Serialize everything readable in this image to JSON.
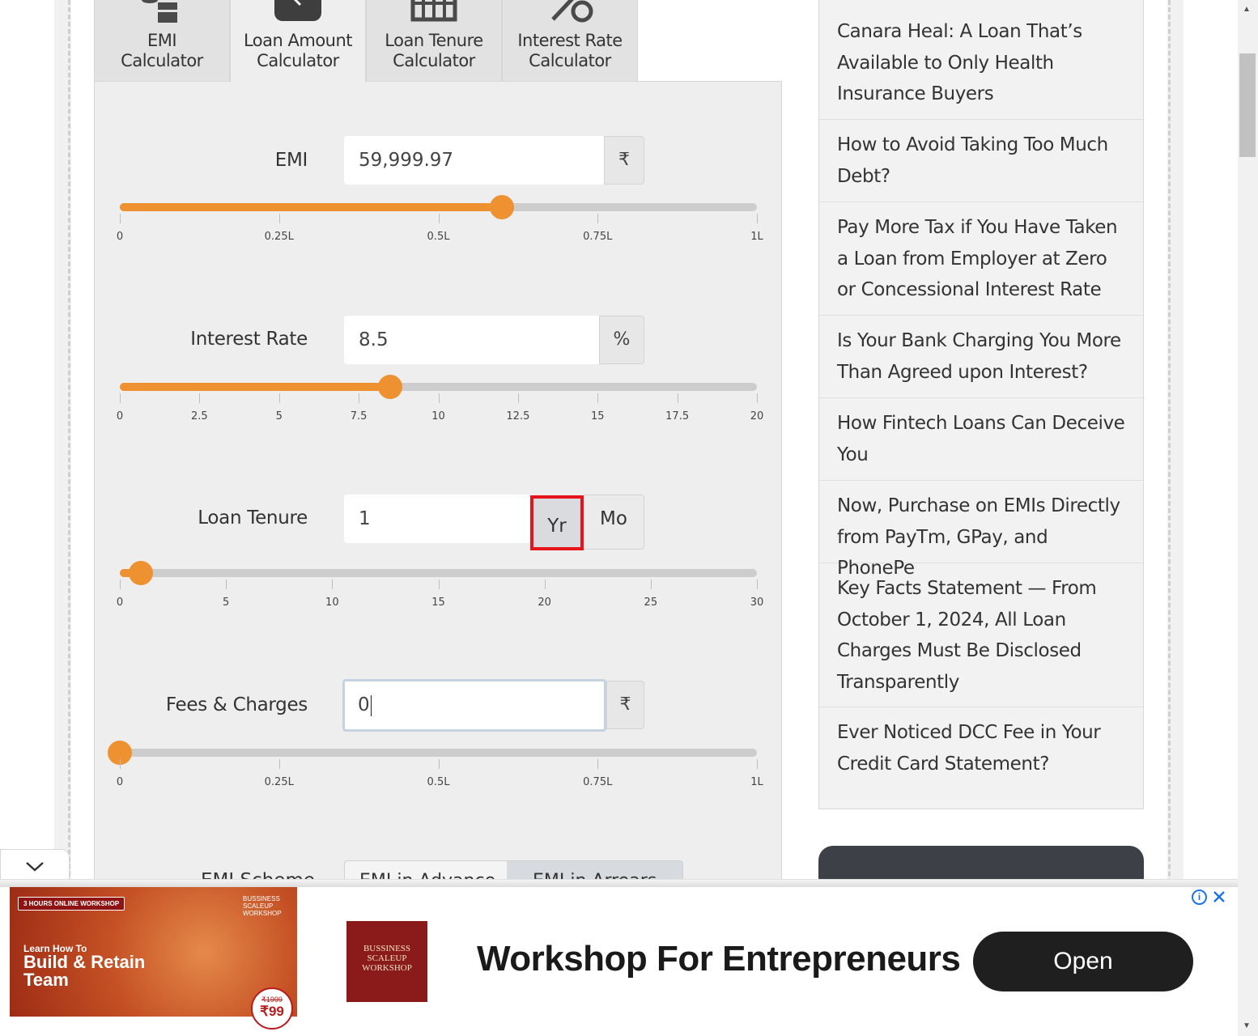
{
  "tabs": [
    {
      "label": "EMI\nCalculator",
      "icon": "coins-icon"
    },
    {
      "label": "Loan Amount\nCalculator",
      "icon": "money-icon"
    },
    {
      "label": "Loan Tenure\nCalculator",
      "icon": "calendar-icon"
    },
    {
      "label": "Interest Rate\nCalculator",
      "icon": "percent-icon"
    }
  ],
  "emi": {
    "label": "EMI",
    "value": "59,999.97",
    "unit": "₹",
    "slider_fraction": 0.6,
    "ticks": [
      "0",
      "0.25L",
      "0.5L",
      "0.75L",
      "1L"
    ]
  },
  "interest": {
    "label": "Interest Rate",
    "value": "8.5",
    "unit": "%",
    "slider_value": 8.5,
    "slider_max": 20,
    "ticks": [
      "0",
      "2.5",
      "5",
      "7.5",
      "10",
      "12.5",
      "15",
      "17.5",
      "20"
    ]
  },
  "tenure": {
    "label": "Loan Tenure",
    "value": "1",
    "unit_yr": "Yr",
    "unit_mo": "Mo",
    "slider_value": 1,
    "slider_max": 30,
    "ticks": [
      "0",
      "5",
      "10",
      "15",
      "20",
      "25",
      "30"
    ]
  },
  "fees": {
    "label": "Fees & Charges",
    "value": "0",
    "unit": "₹",
    "slider_fraction": 0,
    "ticks": [
      "0",
      "0.25L",
      "0.5L",
      "0.75L",
      "1L"
    ]
  },
  "emi_scheme": {
    "label": "EMI Scheme",
    "options": [
      "EMI in Advance",
      "EMI in Arrears"
    ]
  },
  "sidebar": {
    "items": [
      "Canara Heal: A Loan That’s Available to Only Health Insurance Buyers",
      "How to Avoid Taking Too Much Debt?",
      "Pay More Tax if You Have Taken a Loan from Employer at Zero or Concessional Interest Rate",
      "Is Your Bank Charging You More Than Agreed upon Interest?",
      "How Fintech Loans Can Deceive You",
      "Now, Purchase on EMIs Directly from PayTm, GPay, and PhonePe",
      "Key Facts Statement — From October 1, 2024, All Loan Charges Must Be Disclosed Transparently",
      "Ever Noticed DCC Fee in Your Credit Card Statement?"
    ]
  },
  "ad": {
    "image_tag": "3 HOURS ONLINE WORKSHOP",
    "image_brand": "BUSSINESS SCALEUP WORKSHOP",
    "image_text_small": "Learn How To",
    "image_text_big": "Build & Retain Team",
    "price_old": "₹1999",
    "price_new": "₹99",
    "logo_text": "BUSSINESS SCALEUP WORKSHOP",
    "headline": "Workshop For Entrepreneurs",
    "button": "Open"
  },
  "colors": {
    "accent": "#ee9130",
    "highlight_box": "#e8141b"
  }
}
